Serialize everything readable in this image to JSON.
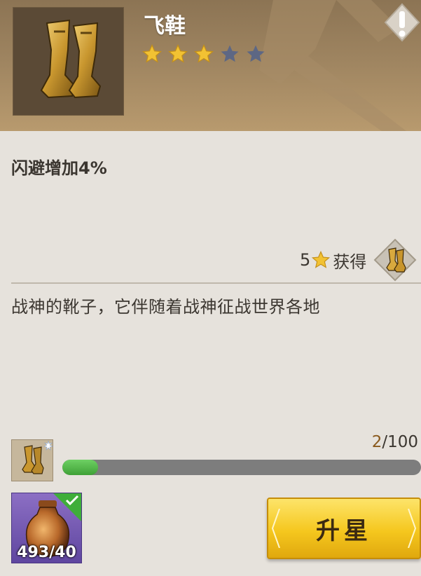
{
  "item": {
    "name": "飞鞋",
    "stars_filled": 3,
    "stars_total": 5,
    "portrait_icon": "golden-boots-icon"
  },
  "effect": "闪避增加4%",
  "obtain": {
    "star_level": "5",
    "label": "获得",
    "icon": "golden-boots-icon"
  },
  "description": "战神的靴子，它伴随着战神征战世界各地",
  "progress": {
    "current": "2",
    "separator": "/",
    "max": "100",
    "fraction": 0.1,
    "icon": "boots-fragment-icon"
  },
  "material": {
    "count_text": "493/40",
    "icon": "bronze-vase-icon",
    "satisfied": true
  },
  "upgrade_button": {
    "label": "升星"
  },
  "colors": {
    "star_gold": "#f2c233",
    "star_empty": "#5d6784",
    "progress_green": "#4db544",
    "button_gold": "#f5c71e",
    "header_brown": "#9e8460"
  }
}
